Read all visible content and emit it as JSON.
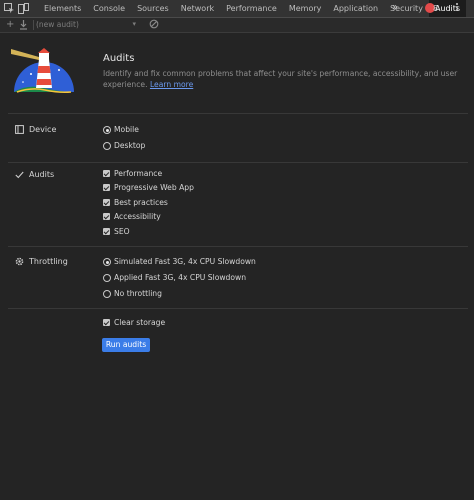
{
  "tabs": [
    {
      "label": "Elements",
      "active": false
    },
    {
      "label": "Console",
      "active": false
    },
    {
      "label": "Sources",
      "active": false
    },
    {
      "label": "Network",
      "active": false
    },
    {
      "label": "Performance",
      "active": false
    },
    {
      "label": "Memory",
      "active": false
    },
    {
      "label": "Application",
      "active": false
    },
    {
      "label": "Security",
      "active": false
    },
    {
      "label": "Audits",
      "active": true
    }
  ],
  "topbar": {
    "more": "»",
    "error_count": "8"
  },
  "toolbar": {
    "plus": "+",
    "report_select": "(new audit)"
  },
  "header": {
    "title": "Audits",
    "description": "Identify and fix common problems that affect your site's performance, accessibility, and user experience.",
    "learn_more": "Learn more"
  },
  "device": {
    "label": "Device",
    "options": [
      {
        "label": "Mobile",
        "selected": true
      },
      {
        "label": "Desktop",
        "selected": false
      }
    ]
  },
  "audits": {
    "label": "Audits",
    "options": [
      {
        "label": "Performance",
        "checked": true
      },
      {
        "label": "Progressive Web App",
        "checked": true
      },
      {
        "label": "Best practices",
        "checked": true
      },
      {
        "label": "Accessibility",
        "checked": true
      },
      {
        "label": "SEO",
        "checked": true
      }
    ]
  },
  "throttling": {
    "label": "Throttling",
    "options": [
      {
        "label": "Simulated Fast 3G, 4x CPU Slowdown",
        "selected": true
      },
      {
        "label": "Applied Fast 3G, 4x CPU Slowdown",
        "selected": false
      },
      {
        "label": "No throttling",
        "selected": false
      }
    ]
  },
  "storage": {
    "label": "Clear storage",
    "checked": true
  },
  "run_button": "Run audits",
  "colors": {
    "accent": "#3b7de8",
    "error": "#e34a4a",
    "link": "#6b9af0"
  }
}
